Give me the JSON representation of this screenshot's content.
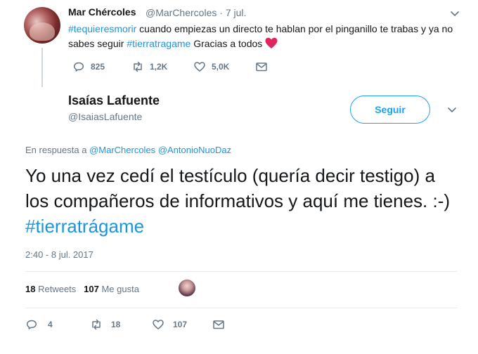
{
  "tweet1": {
    "name": "Mar Chércoles",
    "handle": "@MarChercoles",
    "sep": "·",
    "date": "7 jul.",
    "hashtag1": "#tequieresmorir",
    "text1": " cuando empiezas un directo te hablan por el pinganillo te trabas y ya no sabes seguir ",
    "hashtag2": "#tierratragame",
    "text2": " Gracias a todos ",
    "emoji": "heart-icon",
    "replies": "825",
    "retweets": "1,2K",
    "likes": "5,0K"
  },
  "tweet2": {
    "name": "Isaías Lafuente",
    "handle": "@IsaiasLafuente",
    "follow_label": "Seguir",
    "reply_prefix": "En respuesta a ",
    "reply_user1": "@MarChercoles",
    "reply_user2": "@AntonioNuoDaz",
    "text": "Yo una vez cedí el testículo (quería decir testigo) a los compañeros de informativos y aquí me tienes. :-)  ",
    "hashtag": "#tierratrágame",
    "timestamp": "2:40 - 8 jul. 2017",
    "retweets_count": "18",
    "retweets_label": "Retweets",
    "likes_count": "107",
    "likes_label": "Me gusta",
    "replies": "4",
    "retweets": "18",
    "likes": "107"
  },
  "colors": {
    "link": "#1b95e0",
    "muted": "#657786",
    "heart": "#e0245e",
    "follow": "#1da1f2"
  }
}
